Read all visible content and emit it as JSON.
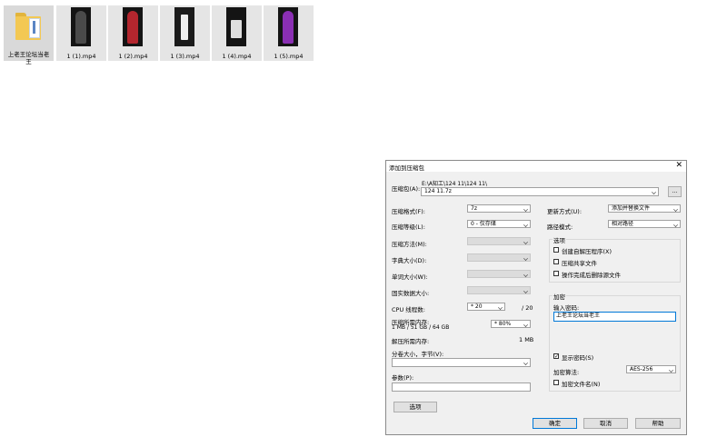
{
  "desktop": {
    "files": [
      {
        "name": "上老王论坛当老王",
        "type": "folder"
      },
      {
        "name": "1 (1).mp4",
        "type": "video",
        "thumb_color": "#2a2a2a"
      },
      {
        "name": "1 (2).mp4",
        "type": "video",
        "thumb_color": "#b3262e"
      },
      {
        "name": "1 (3).mp4",
        "type": "video",
        "thumb_color": "#2c2c2c"
      },
      {
        "name": "1 (4).mp4",
        "type": "video",
        "thumb_color": "#3a3a3a"
      },
      {
        "name": "1 (5).mp4",
        "type": "video",
        "thumb_color": "#8a2fb3"
      }
    ]
  },
  "dialog": {
    "title": "添加到压缩包",
    "close_glyph": "✕",
    "archive": {
      "label": "压缩包(A):",
      "path": "E:\\A知工\\124 11\\124 11\\",
      "value": "124 11.7z",
      "browse_label": "..."
    },
    "left": {
      "format_label": "压缩格式(F):",
      "format_value": "7z",
      "level_label": "压缩等级(L):",
      "level_value": "0 - 仅存储",
      "method_label": "压缩方法(M):",
      "dict_label": "字典大小(D):",
      "word_label": "单词大小(W):",
      "solid_label": "固实数据大小:",
      "cpu_label": "CPU 线程数:",
      "cpu_value": "* 20",
      "cpu_max": "/ 20",
      "mem_label": "压缩所需内存:",
      "mem_detail": "1 MB / 51 GB / 64 GB",
      "mem_value": "* 80%",
      "decomp_label": "解压所需内存:",
      "decomp_value": "1 MB",
      "split_label": "分卷大小，字节(V):",
      "params_label": "参数(P):",
      "options_button": "选项"
    },
    "right": {
      "update_label": "更新方式(U):",
      "update_value": "添加并替换文件",
      "path_label": "路径模式:",
      "path_value": "相对路径",
      "options_group": "选项",
      "opt_sfx": "创建自解压程序(X)",
      "opt_shared": "压缩共享文件",
      "opt_delete": "操作完成后删除源文件",
      "encrypt_group": "加密",
      "password_label": "输入密码:",
      "password_value": "上老王论坛当老王",
      "show_password": "显示密码(S)",
      "show_password_checked": "✓",
      "method_label": "加密算法:",
      "method_value": "AES-256",
      "encrypt_names": "加密文件名(N)"
    },
    "buttons": {
      "ok": "确定",
      "cancel": "取消",
      "help": "帮助"
    }
  }
}
